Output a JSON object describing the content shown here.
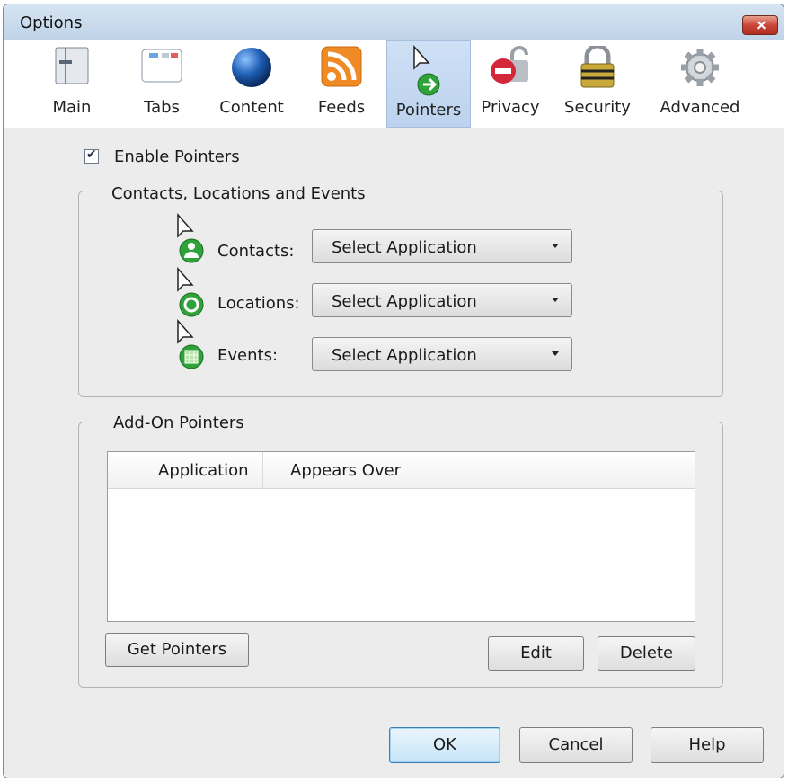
{
  "window": {
    "title": "Options"
  },
  "tabs": [
    {
      "label": "Main",
      "icon": "main-icon"
    },
    {
      "label": "Tabs",
      "icon": "tabs-icon"
    },
    {
      "label": "Content",
      "icon": "globe-icon"
    },
    {
      "label": "Feeds",
      "icon": "rss-icon"
    },
    {
      "label": "Pointers",
      "icon": "pointer-arrow-icon",
      "selected": true
    },
    {
      "label": "Privacy",
      "icon": "privacy-icon"
    },
    {
      "label": "Security",
      "icon": "padlock-icon"
    },
    {
      "label": "Advanced",
      "icon": "gear-icon"
    }
  ],
  "enable": {
    "label": "Enable Pointers",
    "checked": true
  },
  "cle_group": {
    "legend": "Contacts, Locations and Events",
    "rows": [
      {
        "label": "Contacts:",
        "value": "Select Application",
        "icon": "contact-pointer-icon"
      },
      {
        "label": "Locations:",
        "value": "Select Application",
        "icon": "location-pointer-icon"
      },
      {
        "label": "Events:",
        "value": "Select Application",
        "icon": "event-pointer-icon"
      }
    ]
  },
  "addon_group": {
    "legend": "Add-On Pointers",
    "columns": [
      "Application",
      "Appears Over"
    ],
    "rows": [],
    "get_label": "Get Pointers",
    "edit_label": "Edit",
    "delete_label": "Delete"
  },
  "footer": {
    "ok": "OK",
    "cancel": "Cancel",
    "help": "Help"
  },
  "colors": {
    "accent": "#bcd2ee",
    "close": "#c9473a",
    "pointer_green": "#2fa33a"
  }
}
